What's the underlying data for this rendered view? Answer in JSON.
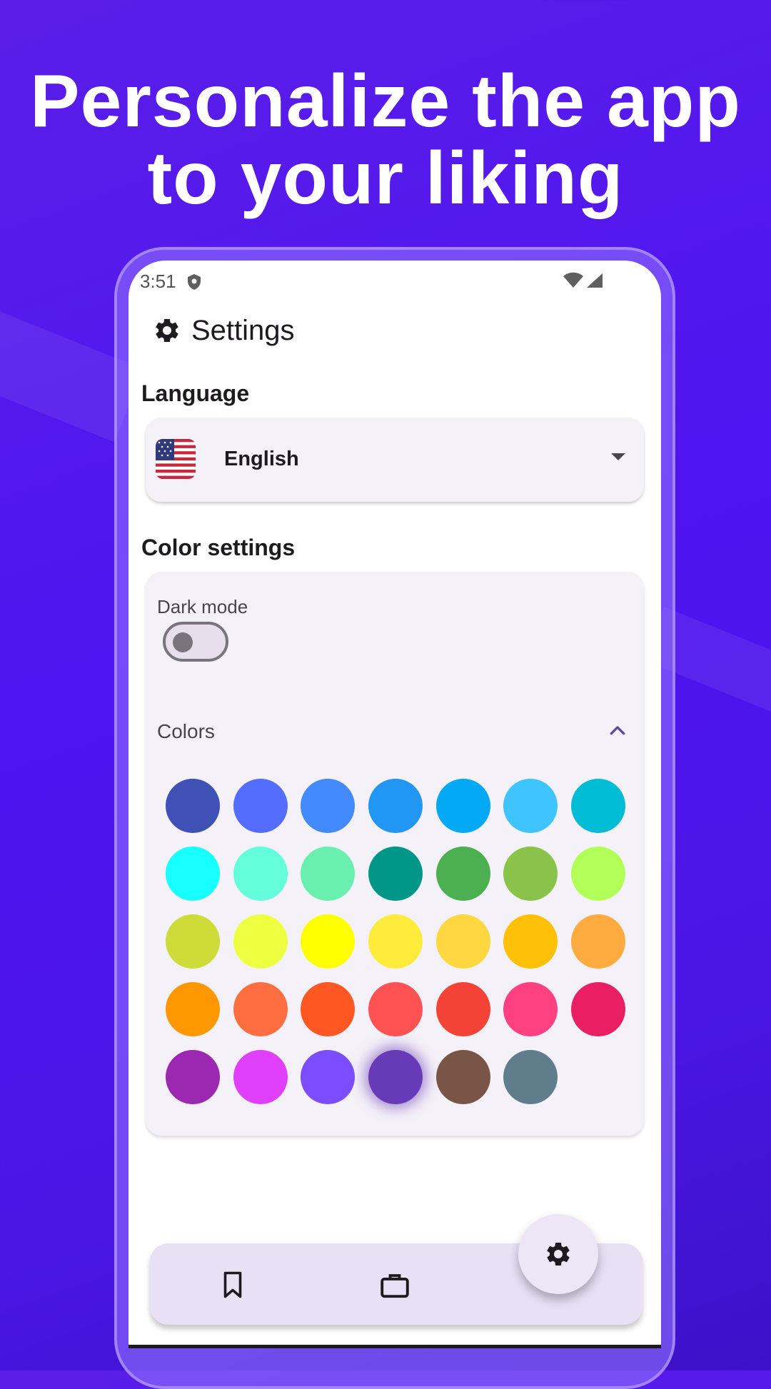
{
  "headline": {
    "line1": "Personalize the app",
    "line2": "to your liking"
  },
  "status_bar": {
    "time": "3:51"
  },
  "app_bar": {
    "title": "Settings"
  },
  "language": {
    "section_label": "Language",
    "selected": "English",
    "flag": "us-flag-icon"
  },
  "color_settings": {
    "section_label": "Color settings",
    "dark_mode_label": "Dark mode",
    "dark_mode_on": false,
    "colors_label": "Colors",
    "colors_expanded": true,
    "selected_swatch_index": 31,
    "swatches": [
      "#3f51b5",
      "#536dfe",
      "#448aff",
      "#2196f3",
      "#03a9f4",
      "#40c4ff",
      "#00bcd4",
      "#18ffff",
      "#64ffda",
      "#69f0ae",
      "#009688",
      "#4caf50",
      "#8bc34a",
      "#b2ff59",
      "#cddc39",
      "#eeff41",
      "#ffff00",
      "#ffeb3b",
      "#ffd740",
      "#ffc107",
      "#ffab40",
      "#ff9800",
      "#ff6e40",
      "#ff5722",
      "#ff5252",
      "#f44336",
      "#ff4081",
      "#e91e63",
      "#9c27b0",
      "#e040fb",
      "#7c4dff",
      "#673ab7",
      "#795548",
      "#607d8b"
    ]
  },
  "bottom_nav": {
    "items": [
      "bookmark-icon",
      "briefcase-icon",
      "gear-icon"
    ],
    "active": "gear-icon"
  },
  "colors": {
    "background": "#4f14f0",
    "primary": "#673ab7",
    "surface": "#f5f1f8"
  }
}
